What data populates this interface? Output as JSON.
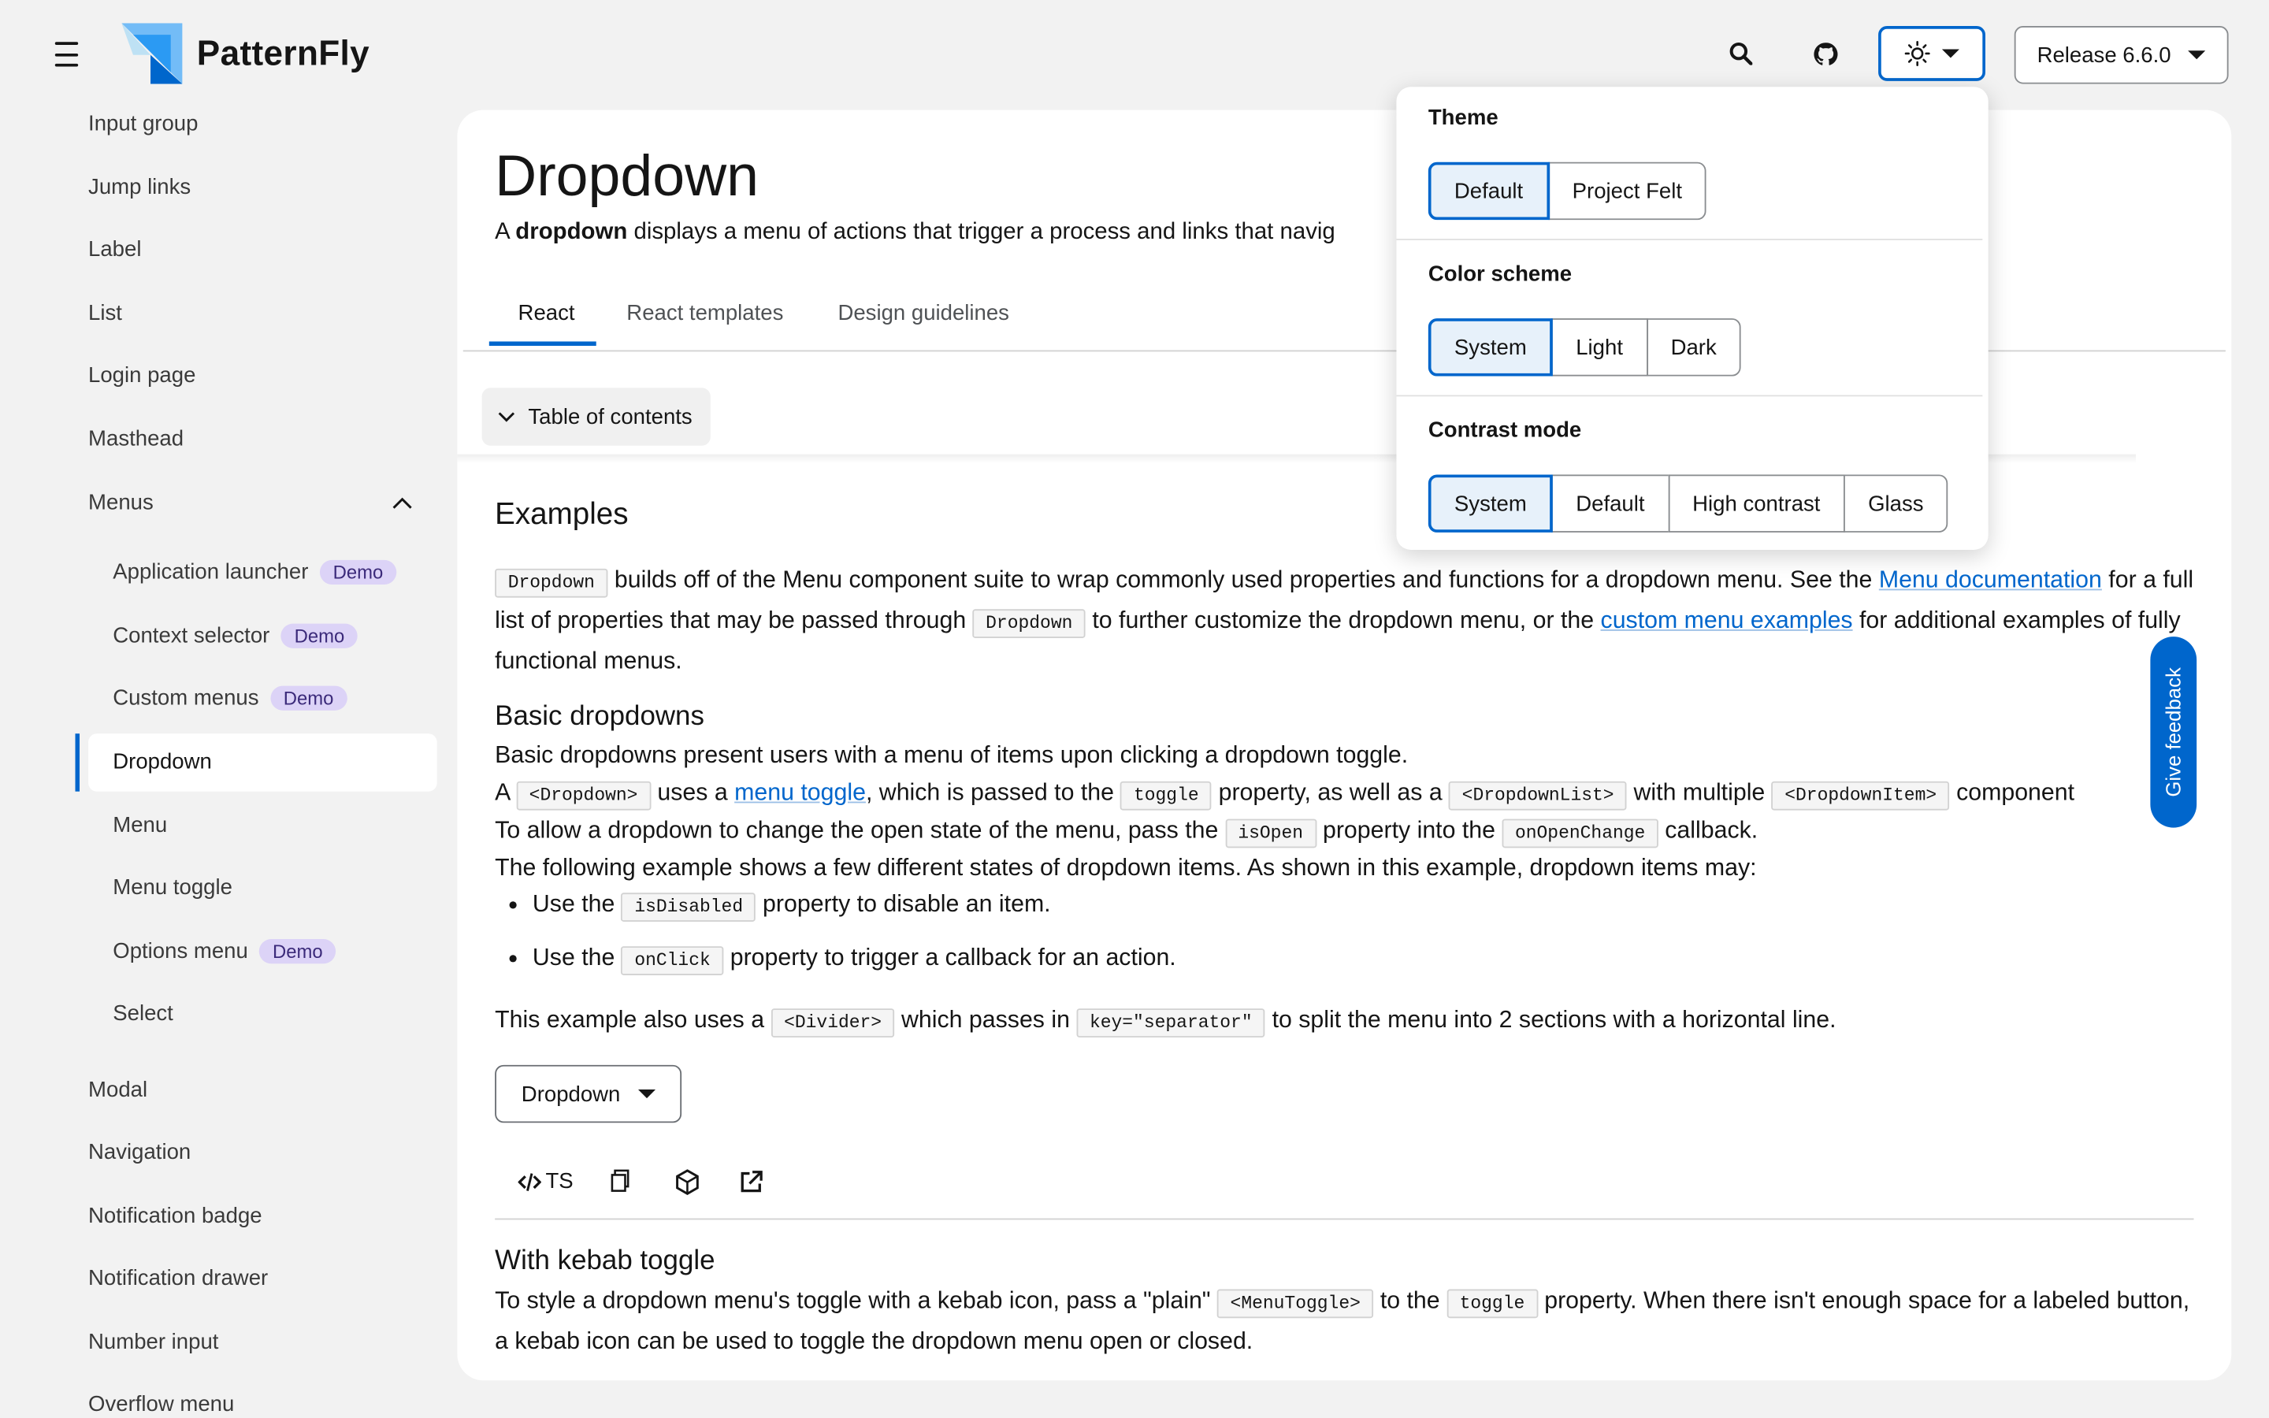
{
  "header": {
    "brand": "PatternFly",
    "release_label": "Release 6.6.0",
    "icons": [
      "menu-icon",
      "search-icon",
      "github-icon",
      "sun-icon"
    ]
  },
  "sidebar": {
    "items": [
      "Input group",
      "Jump links",
      "Label",
      "List",
      "Login page",
      "Masthead"
    ],
    "menus_label": "Menus",
    "sub_items": [
      {
        "label": "Application launcher",
        "badge": "Demo"
      },
      {
        "label": "Context selector",
        "badge": "Demo"
      },
      {
        "label": "Custom menus",
        "badge": "Demo"
      },
      {
        "label": "Dropdown",
        "badge": ""
      },
      {
        "label": "Menu",
        "badge": ""
      },
      {
        "label": "Menu toggle",
        "badge": ""
      },
      {
        "label": "Options menu",
        "badge": "Demo"
      },
      {
        "label": "Select",
        "badge": ""
      }
    ],
    "items_after": [
      "Modal",
      "Navigation",
      "Notification badge",
      "Notification drawer",
      "Number input",
      "Overflow menu"
    ]
  },
  "page": {
    "title": "Dropdown",
    "desc_bold": "dropdown",
    "desc_pre": "A ",
    "desc_post": " displays a menu of actions that trigger a process and links that navig",
    "tabs": [
      "React",
      "React templates",
      "Design guidelines"
    ],
    "toc_label": "Table of contents",
    "examples_heading": "Examples",
    "intro": {
      "code1": "Dropdown",
      "t1": " builds off of the Menu component suite to wrap commonly used properties and functions for a dropdown menu. See the ",
      "link1": "Menu documentation",
      "t2": " for a full list of properties that may be passed through ",
      "code2": "Dropdown",
      "t3": " to further customize the dropdown menu, or the ",
      "link2": "custom menu examples",
      "t4": " for additional examples of fully functional menus."
    },
    "basic_heading": "Basic dropdowns",
    "basic_p1": "Basic dropdowns present users with a menu of items upon clicking a dropdown toggle.",
    "basic_p2": {
      "t1": "A ",
      "c1": "<Dropdown>",
      "t2": " uses a ",
      "link": "menu toggle",
      "t3": ", which is passed to the ",
      "c2": "toggle",
      "t4": " property, as well as a ",
      "c3": "<DropdownList>",
      "t5": " with multiple ",
      "c4": "<DropdownItem>",
      "t6": " component"
    },
    "basic_p3": {
      "t1": "To allow a dropdown to change the open state of the menu, pass the ",
      "c1": "isOpen",
      "t2": " property into the ",
      "c2": "onOpenChange",
      "t3": " callback."
    },
    "basic_p4": "The following example shows a few different states of dropdown items. As shown in this example, dropdown items may:",
    "bullets": [
      {
        "t1": "Use the ",
        "c": "isDisabled",
        "t2": " property to disable an item."
      },
      {
        "t1": "Use the ",
        "c": "onClick",
        "t2": " property to trigger a callback for an action."
      }
    ],
    "basic_p5": {
      "t1": "This example also uses a ",
      "c1": "<Divider>",
      "t2": " which passes in ",
      "c2": "key=\"separator\"",
      "t3": " to split the menu into 2 sections with a horizontal line."
    },
    "example_button": "Dropdown",
    "toolbar_ts": "TS",
    "kebab_heading": "With kebab toggle",
    "kebab_p": {
      "t1": "To style a dropdown menu's toggle with a kebab icon, pass a \"plain\" ",
      "c1": "<MenuToggle>",
      "t2": " to the ",
      "c2": "toggle",
      "t3": " property. When there isn't enough space for a labeled button, a kebab icon can be used to toggle the dropdown menu open or closed."
    }
  },
  "feedback_label": "Give feedback",
  "theme_popover": {
    "theme_label": "Theme",
    "theme_options": [
      "Default",
      "Project Felt"
    ],
    "color_label": "Color scheme",
    "color_options": [
      "System",
      "Light",
      "Dark"
    ],
    "contrast_label": "Contrast mode",
    "contrast_options": [
      "System",
      "Default",
      "High contrast",
      "Glass"
    ]
  },
  "colors": {
    "accent": "#0066cc",
    "badge": "#dcd3f7",
    "background": "#f2f2f2"
  }
}
